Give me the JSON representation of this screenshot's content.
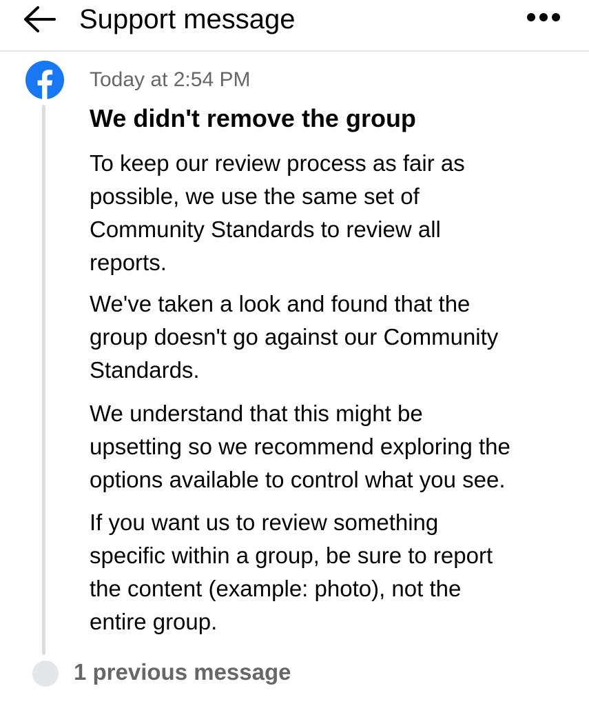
{
  "header": {
    "back_icon": "arrow-left-icon",
    "title": "Support message",
    "more_icon": "more-horizontal-icon"
  },
  "message": {
    "sender_icon": "facebook-logo-icon",
    "brand_color": "#1877F2",
    "timestamp": "Today at 2:54 PM",
    "title": "We didn't remove the group",
    "paragraphs": [
      [
        "To keep our review process as fair as",
        "possible, we use the same set of",
        "Community Standards to review all",
        "reports."
      ],
      [
        "We've taken a look and found that the",
        "group doesn't go against our Community",
        "Standards."
      ],
      [
        "We understand that this might be",
        "upsetting so we recommend exploring the",
        "options available to control what you see."
      ],
      [
        "If you want us to review something",
        "specific within a group, be sure to report",
        "the content (example: photo), not the",
        "entire group."
      ]
    ]
  },
  "footer": {
    "previous_messages": "1 previous message"
  }
}
